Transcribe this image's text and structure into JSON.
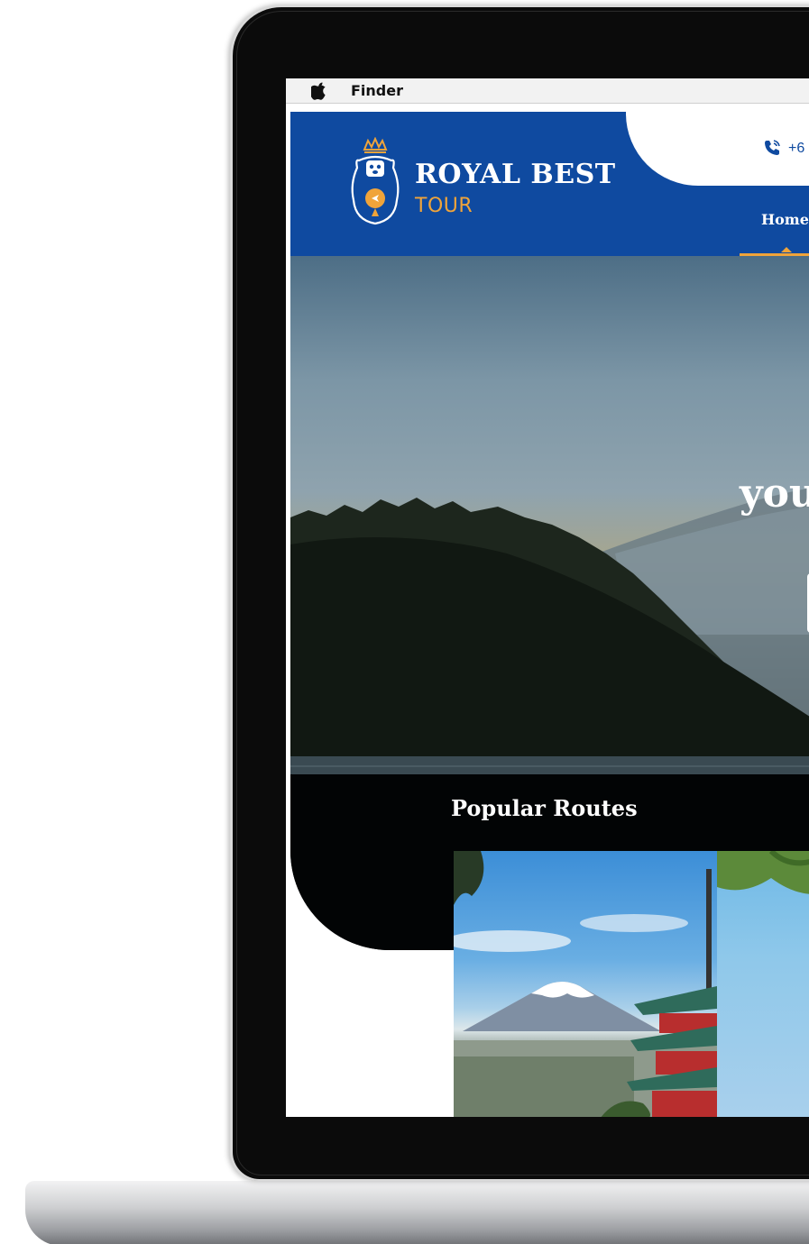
{
  "menubar": {
    "app_name": "Finder",
    "apple_icon": "apple-logo-icon"
  },
  "header": {
    "logo_title": "ROYAL BEST",
    "logo_subtitle": "TOUR",
    "phone_text": "+6",
    "phone_icon": "phone-icon",
    "nav_items": [
      {
        "label": "Home",
        "active": true
      }
    ],
    "colors": {
      "brand_blue": "#0f4aa0",
      "accent_orange": "#f0a43a"
    }
  },
  "hero": {
    "headline_fragment": "you"
  },
  "popular_routes": {
    "title": "Popular Routes"
  }
}
